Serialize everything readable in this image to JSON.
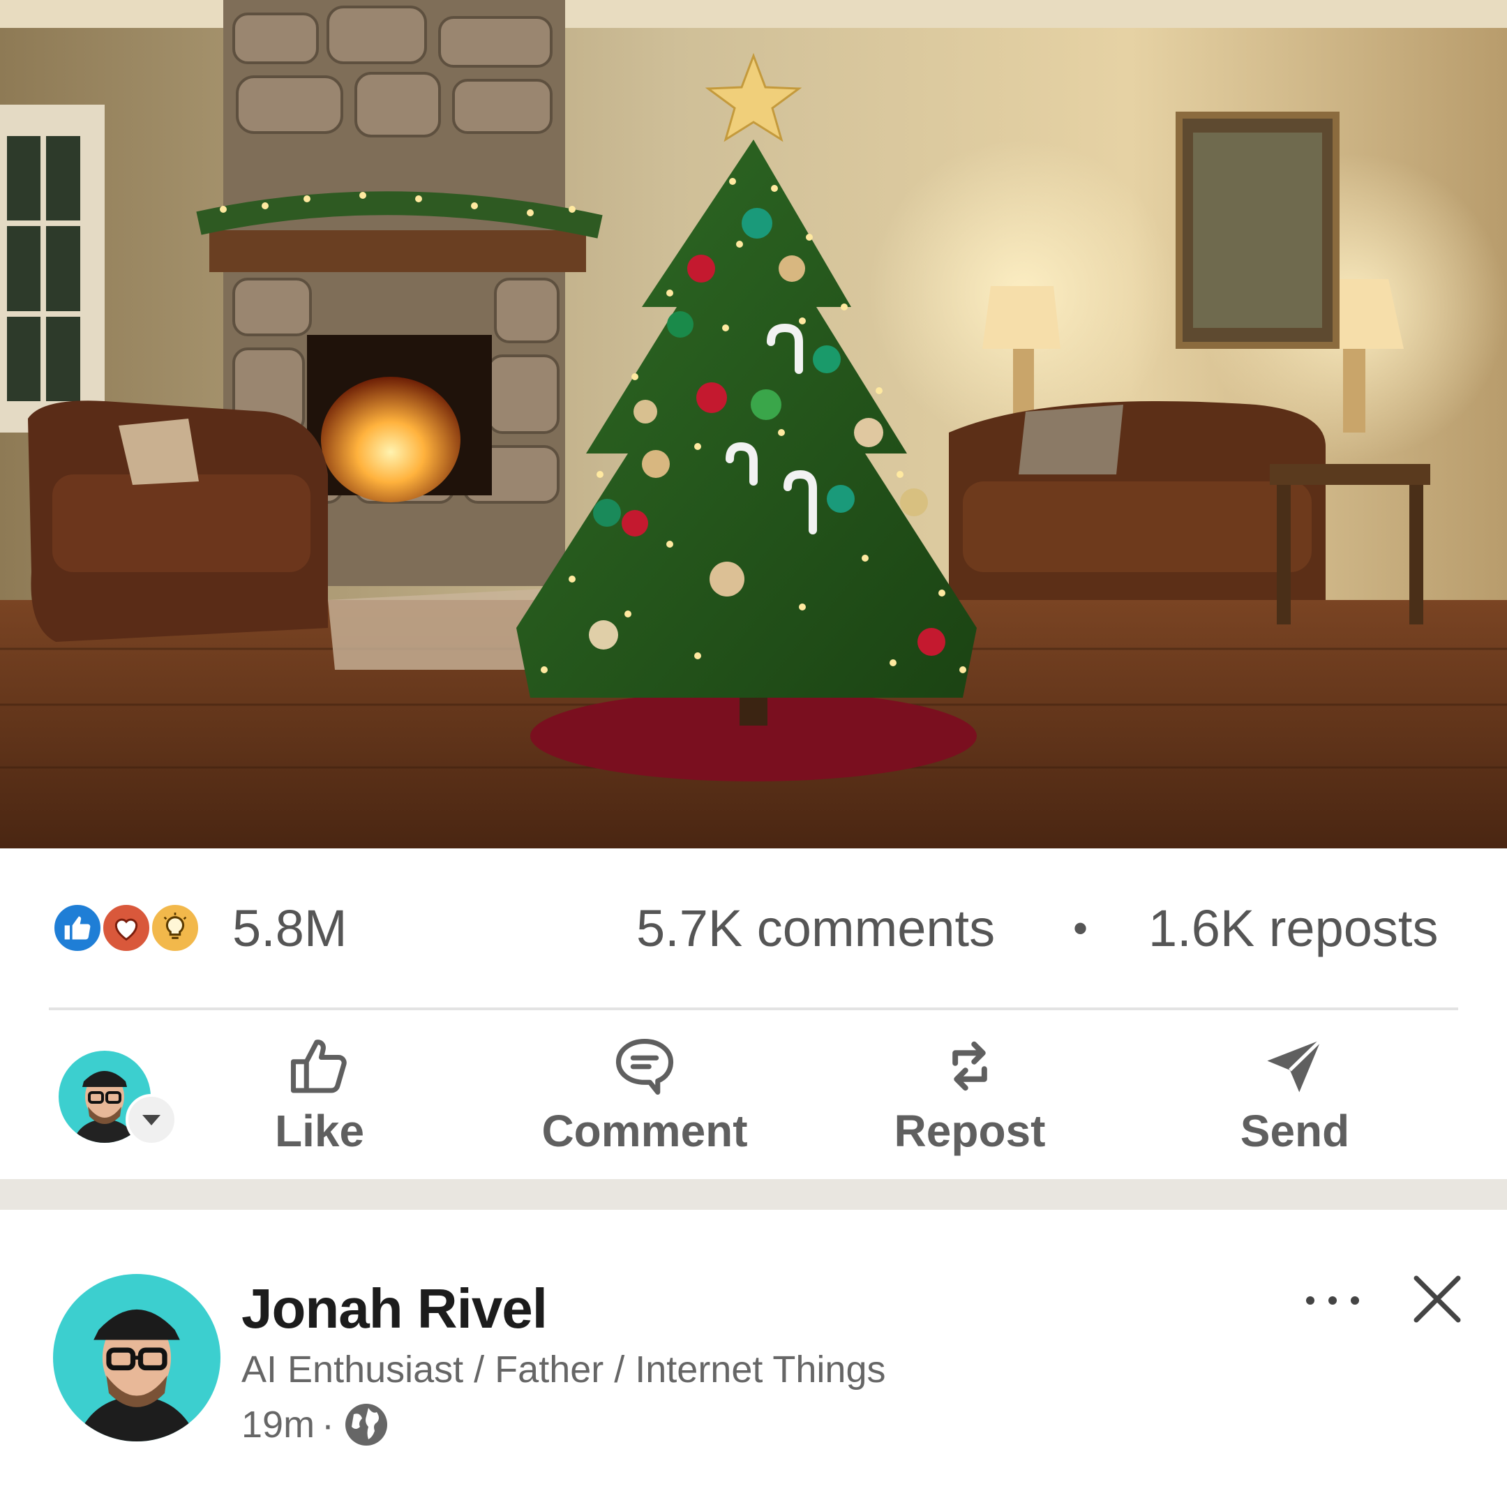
{
  "post": {
    "image_alt_icon": "christmas-tree-living-room-photo",
    "reactions": {
      "icons": [
        "like-reaction-icon",
        "love-reaction-icon",
        "insightful-reaction-icon"
      ],
      "total": "5.8M"
    },
    "comments": "5.7K comments",
    "separator_dot": "•",
    "reposts": "1.6K reposts"
  },
  "action_bar": {
    "like": "Like",
    "comment": "Comment",
    "repost": "Repost",
    "send": "Send"
  },
  "next_post": {
    "author": "Jonah Rivel",
    "tagline": "AI Enthusiast / Father / Internet Things",
    "time": "19m",
    "time_sep": "·",
    "more": "···"
  },
  "colors": {
    "like_blue": "#1f7ed6",
    "love_red": "#d9583b",
    "insight_yellow": "#f2b84b",
    "avatar_teal": "#3ccfcf",
    "action_gray": "#5f5f5f",
    "feed_gap": "#e9e6e0"
  }
}
